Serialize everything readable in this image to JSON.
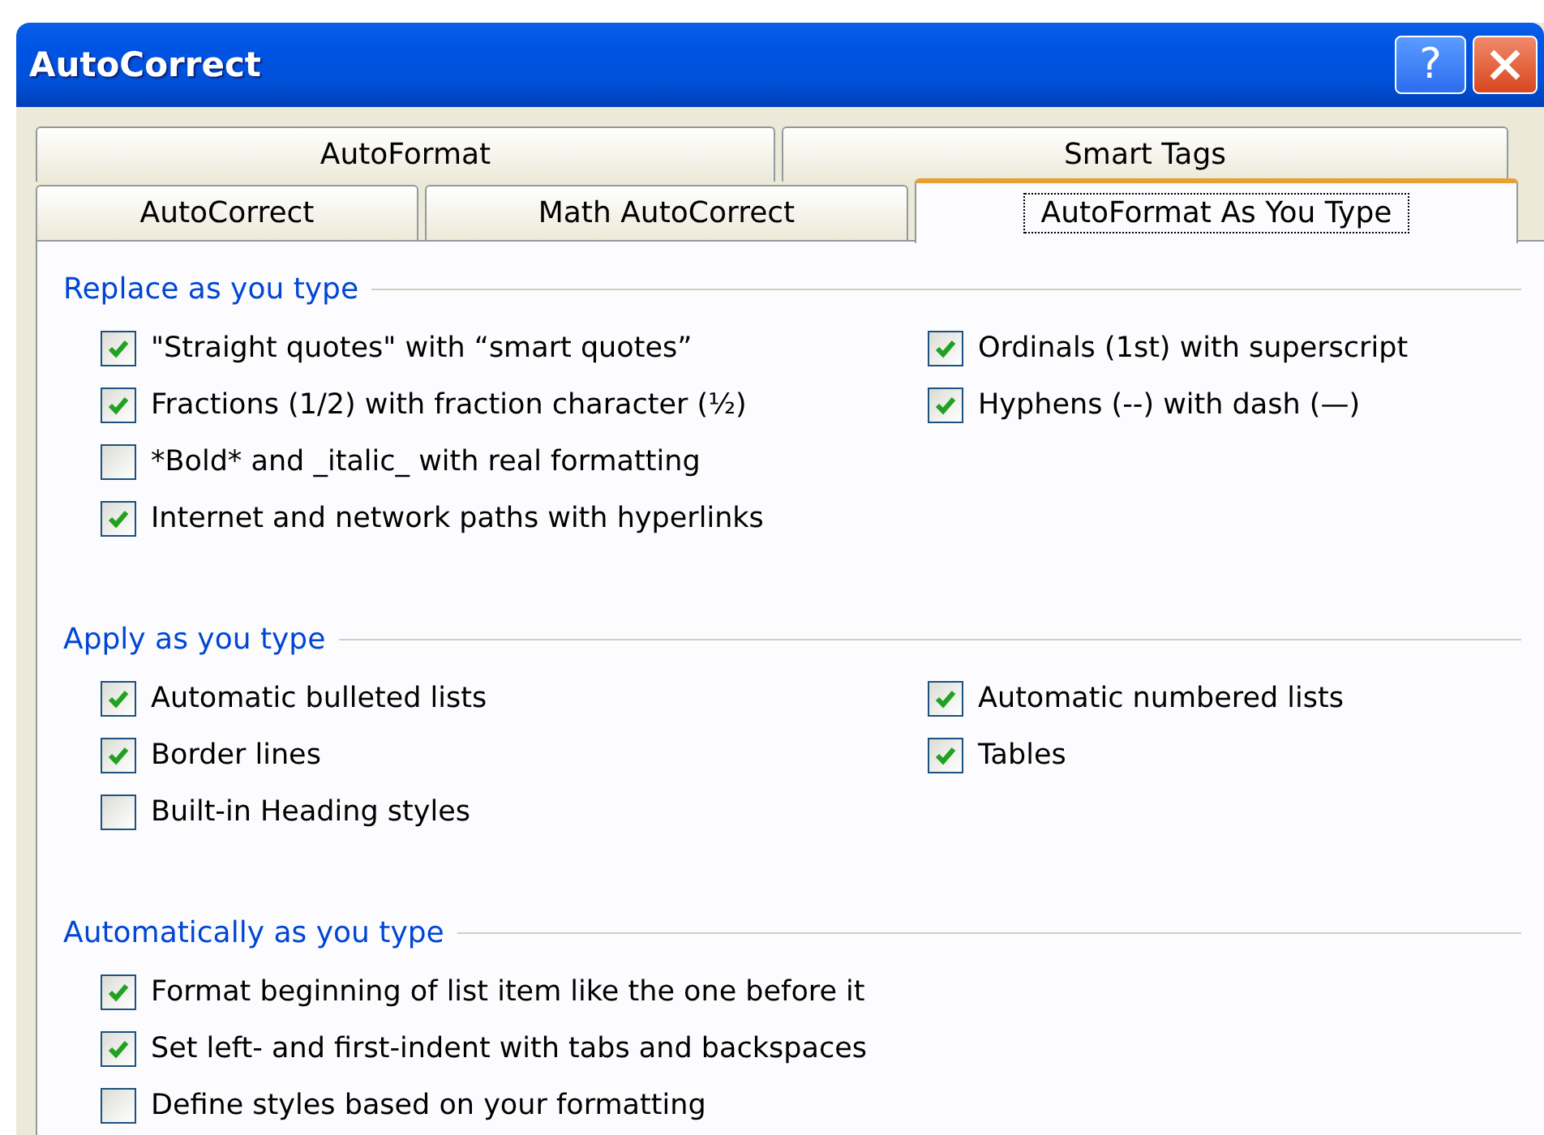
{
  "window": {
    "title": "AutoCorrect",
    "help_button": "?"
  },
  "tab_rows": [
    {
      "tabs": [
        {
          "label": "AutoFormat",
          "selected": false
        },
        {
          "label": "Smart Tags",
          "selected": false
        }
      ]
    },
    {
      "tabs": [
        {
          "label": "AutoCorrect",
          "selected": false
        },
        {
          "label": "Math AutoCorrect",
          "selected": false
        },
        {
          "label": "AutoFormat As You Type",
          "selected": true
        }
      ]
    }
  ],
  "sections": [
    {
      "title": "Replace as you type",
      "left": [
        {
          "label": "\"Straight quotes\" with “smart quotes”",
          "checked": true
        },
        {
          "label": "Fractions (1/2) with fraction character (½)",
          "checked": true
        },
        {
          "label": "*Bold* and _italic_ with real formatting",
          "checked": false
        },
        {
          "label": "Internet and network paths with hyperlinks",
          "checked": true
        }
      ],
      "right": [
        {
          "label": "Ordinals (1st) with superscript",
          "checked": true
        },
        {
          "label": "Hyphens (--) with dash (—)",
          "checked": true
        }
      ]
    },
    {
      "title": "Apply as you type",
      "left": [
        {
          "label": "Automatic bulleted lists",
          "checked": true
        },
        {
          "label": "Border lines",
          "checked": true
        },
        {
          "label": "Built-in Heading styles",
          "checked": false
        }
      ],
      "right": [
        {
          "label": "Automatic numbered lists",
          "checked": true
        },
        {
          "label": "Tables",
          "checked": true
        }
      ]
    },
    {
      "title": "Automatically as you type",
      "left": [
        {
          "label": "Format beginning of list item like the one before it",
          "checked": true
        },
        {
          "label": "Set left- and first-indent with tabs and backspaces",
          "checked": true
        },
        {
          "label": "Define styles based on your formatting",
          "checked": false
        }
      ]
    }
  ]
}
